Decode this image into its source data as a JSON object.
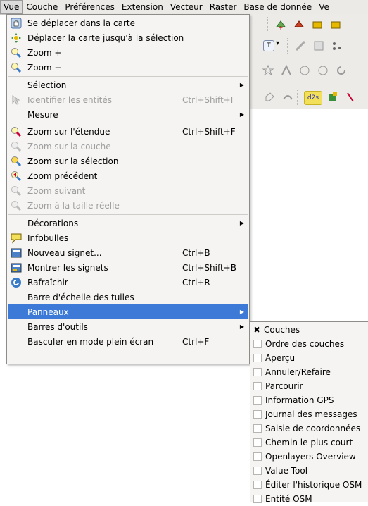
{
  "menubar": {
    "items": [
      "Vue",
      "Couche",
      "Préférences",
      "Extension",
      "Vecteur",
      "Raster",
      "Base de donnée",
      "Ve"
    ]
  },
  "view_menu": {
    "items": [
      {
        "label": "Se déplacer dans la carte",
        "icon": "pan-hand-icon"
      },
      {
        "label": "Déplacer la carte jusqu'à la sélection",
        "icon": "pan-to-selection-icon"
      },
      {
        "label": "Zoom +",
        "icon": "zoom-in-icon"
      },
      {
        "label": "Zoom −",
        "icon": "zoom-out-icon"
      },
      {
        "label": "Sélection",
        "submenu": true
      },
      {
        "label": "Identifier les entités",
        "shortcut": "Ctrl+Shift+I",
        "icon": "identify-icon",
        "disabled": true
      },
      {
        "label": "Mesure",
        "submenu": true
      },
      {
        "label": "Zoom sur l'étendue",
        "shortcut": "Ctrl+Shift+F",
        "icon": "zoom-full-icon"
      },
      {
        "label": "Zoom sur la couche",
        "icon": "zoom-layer-icon",
        "disabled": true
      },
      {
        "label": "Zoom sur la sélection",
        "icon": "zoom-selection-icon"
      },
      {
        "label": "Zoom précédent",
        "icon": "zoom-last-icon"
      },
      {
        "label": "Zoom suivant",
        "icon": "zoom-next-icon",
        "disabled": true
      },
      {
        "label": "Zoom à la taille réelle",
        "icon": "zoom-actual-icon",
        "disabled": true
      },
      {
        "label": "Décorations",
        "submenu": true
      },
      {
        "label": "Infobulles",
        "icon": "map-tips-icon"
      },
      {
        "label": "Nouveau signet...",
        "shortcut": "Ctrl+B",
        "icon": "new-bookmark-icon"
      },
      {
        "label": "Montrer les signets",
        "shortcut": "Ctrl+Shift+B",
        "icon": "show-bookmarks-icon"
      },
      {
        "label": "Rafraîchir",
        "shortcut": "Ctrl+R",
        "icon": "refresh-icon"
      },
      {
        "label": "Barre d'échelle des tuiles"
      },
      {
        "label": "Panneaux",
        "submenu": true,
        "highlighted": true
      },
      {
        "label": "Barres d'outils",
        "submenu": true
      },
      {
        "label": "Basculer en mode plein écran",
        "shortcut": "Ctrl+F"
      }
    ]
  },
  "panels_submenu": {
    "items": [
      {
        "label": "Couches",
        "checked": true
      },
      {
        "label": "Ordre des couches",
        "checked": false
      },
      {
        "label": "Aperçu",
        "checked": false
      },
      {
        "label": "Annuler/Refaire",
        "checked": false
      },
      {
        "label": "Parcourir",
        "checked": false
      },
      {
        "label": "Information GPS",
        "checked": false
      },
      {
        "label": "Journal des messages",
        "checked": false
      },
      {
        "label": "Saisie de coordonnées",
        "checked": false
      },
      {
        "label": "Chemin le plus court",
        "checked": false
      },
      {
        "label": "Openlayers Overview",
        "checked": false
      },
      {
        "label": "Value Tool",
        "checked": false
      },
      {
        "label": "Éditer l'historique OSM",
        "checked": false
      },
      {
        "label": "Entité OSM",
        "checked": false
      }
    ]
  },
  "toolbar_glyphs": {
    "text_tool": "T",
    "dropdown_arrow": "▾",
    "label_tool": "d2s"
  },
  "colors": {
    "highlight": "#3d7ad8",
    "menu_bg": "#f5f4f2",
    "menubar_bg": "#eceae7"
  }
}
